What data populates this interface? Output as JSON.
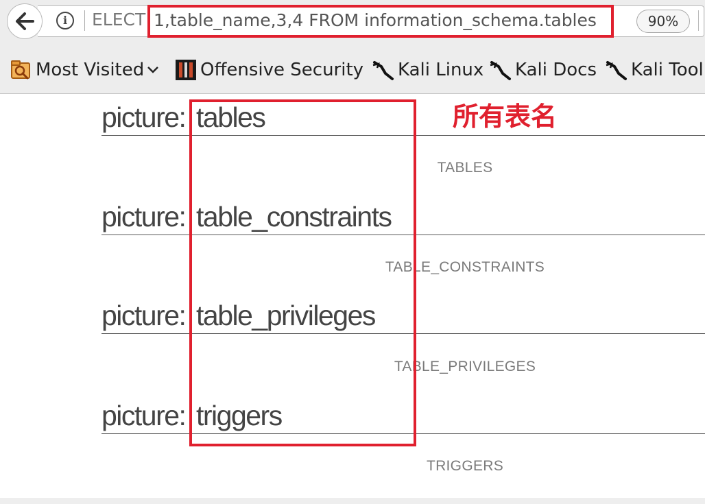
{
  "browser": {
    "url_left": "ELECT",
    "url_highlight": "1,table_name,3,4 FROM information_schema.tables",
    "zoom": "90%",
    "bookmarks": [
      {
        "label": "Most Visited",
        "icon": "most-visited-icon"
      },
      {
        "label": "Offensive Security",
        "icon": "offensive-security-icon"
      },
      {
        "label": "Kali Linux",
        "icon": "kali-dragon-icon"
      },
      {
        "label": "Kali Docs",
        "icon": "kali-dragon-icon"
      },
      {
        "label": "Kali Tool",
        "icon": "kali-dragon-icon"
      }
    ]
  },
  "content": {
    "rows": [
      {
        "prefix": "picture:",
        "name": "tables",
        "upper": "TABLES"
      },
      {
        "prefix": "picture:",
        "name": "table_constraints",
        "upper": "TABLE_CONSTRAINTS"
      },
      {
        "prefix": "picture:",
        "name": "table_privileges",
        "upper": "TABLE_PRIVILEGES"
      },
      {
        "prefix": "picture:",
        "name": "triggers",
        "upper": "TRIGGERS"
      }
    ],
    "annotation": "所有表名"
  },
  "colors": {
    "highlight": "#e0202e",
    "text": "#444444",
    "muted": "#7a7a7a"
  }
}
